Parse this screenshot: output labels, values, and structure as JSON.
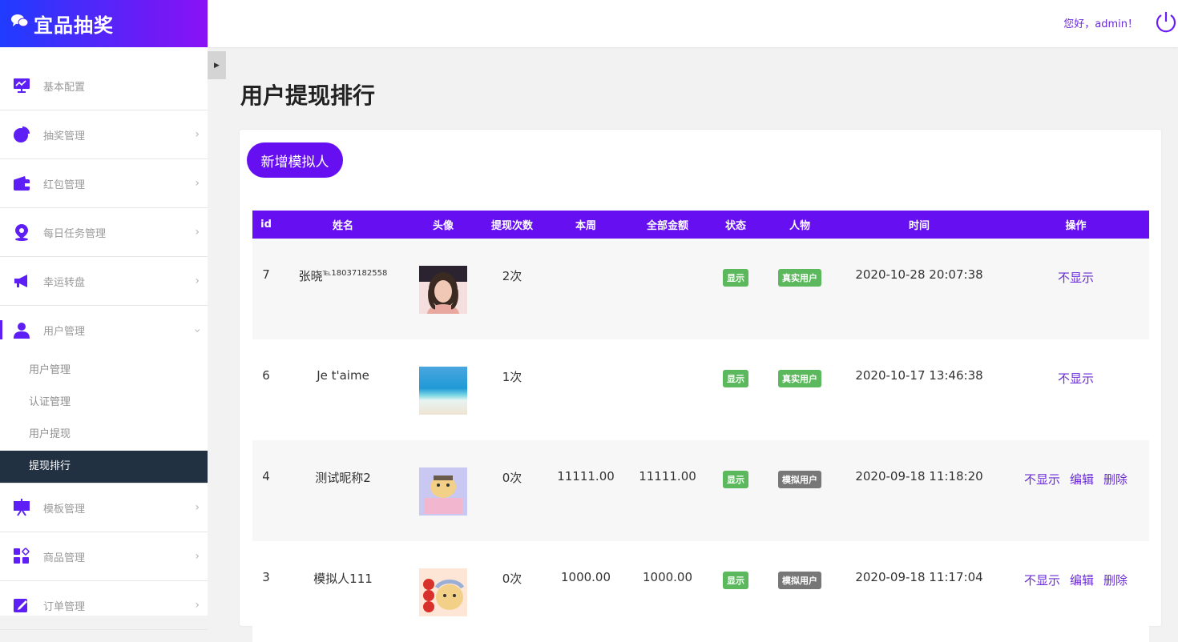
{
  "brand": {
    "title": "宜品抽奖"
  },
  "sidebar": {
    "items": [
      {
        "label": "基本配置"
      },
      {
        "label": "抽奖管理"
      },
      {
        "label": "红包管理"
      },
      {
        "label": "每日任务管理"
      },
      {
        "label": "幸运转盘"
      },
      {
        "label": "用户管理"
      },
      {
        "label": "模板管理"
      },
      {
        "label": "商品管理"
      },
      {
        "label": "订单管理"
      }
    ],
    "subitems": [
      {
        "label": "用户管理"
      },
      {
        "label": "认证管理"
      },
      {
        "label": "用户提现"
      },
      {
        "label": "提现排行"
      }
    ]
  },
  "header": {
    "greeting": "您好，admin！"
  },
  "page": {
    "title": "用户提现排行",
    "add_button": "新增模拟人"
  },
  "table": {
    "headers": [
      "id",
      "姓名",
      "头像",
      "提现次数",
      "本周",
      "全部金额",
      "状态",
      "人物",
      "时间",
      "操作"
    ],
    "rows": [
      {
        "id": "7",
        "name": "张晓",
        "name_sup": "℡18037182558",
        "count": "2次",
        "week": "",
        "total": "",
        "status": "显示",
        "type": "真实用户",
        "time": "2020-10-28 20:07:38",
        "ops": [
          "不显示"
        ]
      },
      {
        "id": "6",
        "name": "Je t'aime",
        "name_sup": "",
        "count": "1次",
        "week": "",
        "total": "",
        "status": "显示",
        "type": "真实用户",
        "time": "2020-10-17 13:46:38",
        "ops": [
          "不显示"
        ]
      },
      {
        "id": "4",
        "name": "测试昵称2",
        "name_sup": "",
        "count": "0次",
        "week": "11111.00",
        "total": "11111.00",
        "status": "显示",
        "type": "模拟用户",
        "time": "2020-09-18 11:18:20",
        "ops": [
          "不显示",
          "编辑",
          "删除"
        ]
      },
      {
        "id": "3",
        "name": "模拟人111",
        "name_sup": "",
        "count": "0次",
        "week": "1000.00",
        "total": "1000.00",
        "status": "显示",
        "type": "模拟用户",
        "time": "2020-09-18 11:17:04",
        "ops": [
          "不显示",
          "编辑",
          "删除"
        ]
      }
    ]
  },
  "colors": {
    "accent": "#6610f2",
    "active_bg": "#223142",
    "status_green": "#5cb85c",
    "sim_gray": "#777777"
  },
  "icons": [
    "chat-icon",
    "monitor-icon",
    "pie-chart-icon",
    "wallet-icon",
    "map-pin-icon",
    "megaphone-icon",
    "user-icon",
    "easel-icon",
    "apps-icon",
    "edit-icon",
    "power-icon"
  ]
}
